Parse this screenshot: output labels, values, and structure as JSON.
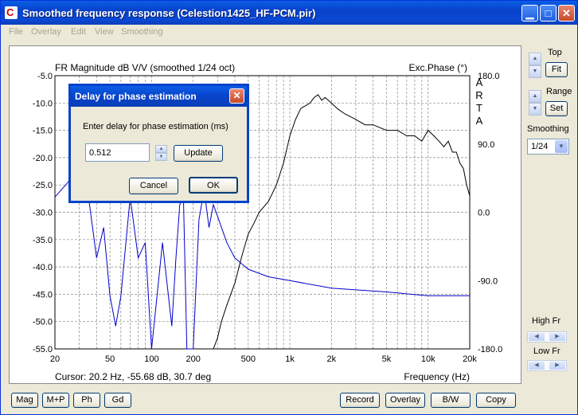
{
  "window": {
    "title": "Smoothed frequency response (Celestion1425_HF-PCM.pir)",
    "app_icon_letter": "C"
  },
  "menu": [
    "File",
    "Overlay",
    "Edit",
    "View",
    "Smoothing"
  ],
  "plot": {
    "mag_title": "FR Magnitude dB V/V (smoothed 1/24 oct)",
    "phase_title": "Exc.Phase (°)",
    "arta_letters": [
      "A",
      "R",
      "T",
      "A"
    ],
    "y_ticks": [
      "-5.0",
      "-10.0",
      "-15.0",
      "-20.0",
      "-25.0",
      "-30.0",
      "-35.0",
      "-40.0",
      "-45.0",
      "-50.0",
      "-55.0"
    ],
    "phase_ticks": [
      "180.0",
      "90.0",
      "0.0",
      "-90.0",
      "-180.0"
    ],
    "x_ticks": [
      "20",
      "50",
      "100",
      "200",
      "500",
      "1k",
      "2k",
      "5k",
      "10k",
      "20k"
    ],
    "cursor": "Cursor: 20.2 Hz, -55.68 dB, 30.7 deg",
    "x_label": "Frequency (Hz)"
  },
  "chart_data": {
    "type": "line",
    "title": "FR Magnitude dB V/V (smoothed 1/24 oct)",
    "xlabel": "Frequency (Hz)",
    "ylabel": "",
    "x_scale": "log",
    "xlim": [
      20,
      20000
    ],
    "ylim": [
      -55,
      -5
    ],
    "phase_ylim": [
      -180,
      180
    ],
    "series": [
      {
        "axis": "magnitude_db",
        "color": "#000000",
        "x": [
          250,
          280,
          300,
          320,
          350,
          400,
          450,
          500,
          550,
          600,
          700,
          800,
          900,
          1000,
          1100,
          1200,
          1300,
          1400,
          1500,
          1600,
          1700,
          1800,
          2000,
          2200,
          2500,
          3000,
          3500,
          4000,
          5000,
          6000,
          7000,
          8000,
          9000,
          10000,
          11000,
          12000,
          13000,
          14000,
          15000,
          16000,
          17000,
          18000,
          19000,
          20000
        ],
        "y": [
          -55,
          -55,
          -53,
          -50,
          -47,
          -43,
          -38,
          -34,
          -32,
          -30,
          -28,
          -25,
          -21,
          -16,
          -13,
          -11,
          -10.5,
          -10,
          -9,
          -8.5,
          -9.5,
          -9,
          -10,
          -11,
          -12,
          -13,
          -14,
          -14,
          -15,
          -15,
          -16,
          -16,
          -17,
          -15,
          -16,
          -17,
          -18,
          -17,
          -19,
          -19,
          -21,
          -22,
          -25,
          -27
        ]
      },
      {
        "axis": "phase_deg",
        "color": "#0000cc",
        "x": [
          20,
          25,
          30,
          35,
          40,
          45,
          50,
          55,
          60,
          70,
          80,
          90,
          100,
          120,
          140,
          150,
          160,
          170,
          180,
          200,
          220,
          240,
          260,
          280,
          300,
          350,
          400,
          500,
          700,
          1000,
          2000,
          5000,
          10000,
          15000,
          20000
        ],
        "y": [
          20,
          40,
          80,
          20,
          -60,
          -20,
          -110,
          -150,
          -110,
          20,
          -60,
          -40,
          -180,
          -40,
          -150,
          -60,
          10,
          20,
          -180,
          -180,
          -10,
          30,
          -20,
          10,
          -5,
          -40,
          -60,
          -75,
          -85,
          -90,
          -100,
          -105,
          -110,
          -110,
          -110
        ]
      }
    ]
  },
  "sidebar": {
    "top_label": "Top",
    "fit_button": "Fit",
    "range_label": "Range",
    "set_button": "Set",
    "smoothing_label": "Smoothing",
    "smoothing_value": "1/24",
    "high_fr_label": "High Fr",
    "low_fr_label": "Low Fr"
  },
  "bottom_left": [
    "Mag",
    "M+P",
    "Ph",
    "Gd"
  ],
  "bottom_right": [
    "Record",
    "Overlay",
    "B/W",
    "Copy"
  ],
  "dialog": {
    "title": "Delay for phase estimation",
    "prompt": "Enter delay for phase estimation (ms)",
    "delay_value": "0.512",
    "update_button": "Update",
    "cancel_button": "Cancel",
    "ok_button": "OK"
  },
  "colors": {
    "magnitude": "#000000",
    "phase": "#0000cc",
    "titlebar": "#0842c9"
  }
}
